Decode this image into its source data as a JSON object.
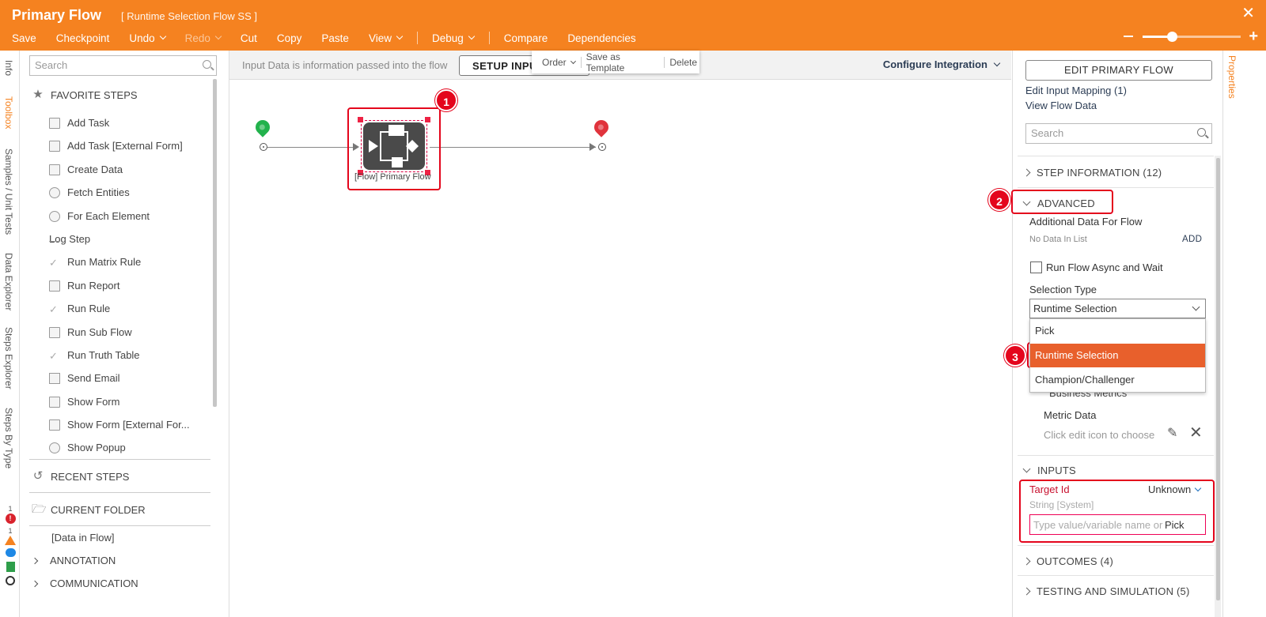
{
  "header": {
    "title": "Primary Flow",
    "subtitle": "[ Runtime Selection Flow SS ]",
    "close": "✕"
  },
  "menu": [
    {
      "label": "Save",
      "disabled": false,
      "dropdown": false
    },
    {
      "label": "Checkpoint",
      "disabled": false,
      "dropdown": false
    },
    {
      "label": "Undo",
      "disabled": false,
      "dropdown": true
    },
    {
      "label": "Redo",
      "disabled": true,
      "dropdown": true
    },
    {
      "label": "Cut",
      "disabled": false,
      "dropdown": false
    },
    {
      "label": "Copy",
      "disabled": false,
      "dropdown": false
    },
    {
      "label": "Paste",
      "disabled": false,
      "dropdown": false
    },
    {
      "label": "View",
      "disabled": false,
      "dropdown": true
    },
    {
      "label": "Debug",
      "disabled": false,
      "dropdown": true
    },
    {
      "label": "Compare",
      "disabled": false,
      "dropdown": false
    },
    {
      "label": "Dependencies",
      "disabled": false,
      "dropdown": false
    }
  ],
  "left_tabs": {
    "info": "Info",
    "toolbox": "Toolbox",
    "samples": "Samples / Unit Tests",
    "data_explorer": "Data Explorer",
    "steps_explorer": "Steps Explorer",
    "steps_by_type": "Steps By Type",
    "error_count": "1",
    "warning_count": "1"
  },
  "toolbox": {
    "search_placeholder": "Search",
    "favorite_header": "FAVORITE STEPS",
    "items": [
      {
        "label": "Add Task",
        "icon": "form-icon"
      },
      {
        "label": "Add Task [External Form]",
        "icon": "form-icon"
      },
      {
        "label": "Create Data",
        "icon": "document-icon"
      },
      {
        "label": "Fetch Entities",
        "icon": "database-icon"
      },
      {
        "label": "For Each Element",
        "icon": "loop-icon"
      },
      {
        "label": "Log Step",
        "icon": "pulse-icon"
      },
      {
        "label": "Run Matrix Rule",
        "icon": "rule-icon"
      },
      {
        "label": "Run Report",
        "icon": "report-icon"
      },
      {
        "label": "Run Rule",
        "icon": "rule-icon"
      },
      {
        "label": "Run Sub Flow",
        "icon": "subflow-icon"
      },
      {
        "label": "Run Truth Table",
        "icon": "rule-icon"
      },
      {
        "label": "Send Email",
        "icon": "envelope-icon"
      },
      {
        "label": "Show Form",
        "icon": "form-icon"
      },
      {
        "label": "Show Form [External For...",
        "icon": "form-icon"
      },
      {
        "label": "Show Popup",
        "icon": "popup-icon"
      }
    ],
    "recent_header": "RECENT STEPS",
    "current_folder_header": "CURRENT FOLDER",
    "data_in_flow": "[Data in Flow]",
    "categories": [
      "ANNOTATION",
      "COMMUNICATION"
    ]
  },
  "canvas": {
    "info_text": "Input Data is information passed into the flow",
    "setup_button": "SETUP INPUTS",
    "configure": "Configure Integration",
    "context_menu": {
      "order": "Order",
      "save_template": "Save as Template",
      "delete": "Delete"
    },
    "step_label": "[Flow] Primary Flow"
  },
  "callouts": [
    "1",
    "2",
    "3"
  ],
  "properties": {
    "tab_label": "Properties",
    "edit_button": "EDIT PRIMARY FLOW",
    "edit_input_mapping": "Edit Input Mapping (1)",
    "view_flow_data": "View Flow Data",
    "search_placeholder": "Search",
    "step_information": "STEP INFORMATION (12)",
    "advanced": "ADVANCED",
    "additional_data": "Additional Data For Flow",
    "no_data": "No Data In List",
    "add": "ADD",
    "run_async": "Run Flow Async and Wait",
    "selection_type_label": "Selection Type",
    "selection_type_value": "Runtime Selection",
    "options": [
      "Pick",
      "Runtime Selection",
      "Champion/Challenger"
    ],
    "selected_option_index": 1,
    "business_metrics": "Business Metrics",
    "metric_data": "Metric Data",
    "metric_hint": "Click edit icon to choose",
    "inputs": "INPUTS",
    "target_id": "Target Id",
    "target_unknown": "Unknown",
    "target_type": "String [System]",
    "target_placeholder": "Type value/variable name or",
    "target_pick": "Pick",
    "outcomes": "OUTCOMES (4)",
    "testing": "TESTING AND SIMULATION (5)"
  },
  "colors": {
    "accent": "#f58220",
    "callout_red": "#e4051c",
    "selected_option": "#e8602c",
    "start_pin": "#22b24c",
    "end_pin": "#e0333c"
  }
}
